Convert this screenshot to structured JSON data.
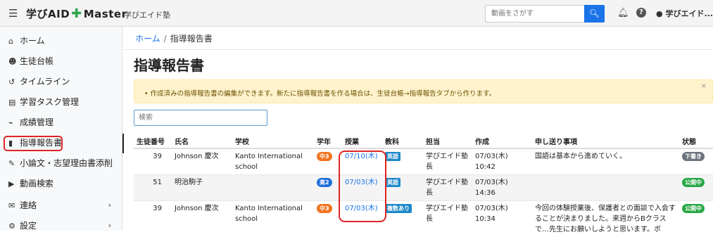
{
  "header": {
    "menu_icon": "hamburger-icon",
    "brand_left": "学びAID",
    "brand_right": "Master",
    "school": "学びエイド塾",
    "search_placeholder": "動画をさがす",
    "user_name": "学びエイド..."
  },
  "sidebar": {
    "items": [
      {
        "label": "ホーム",
        "icon": "home-icon"
      },
      {
        "label": "生徒台帳",
        "icon": "users-icon"
      },
      {
        "label": "タイムライン",
        "icon": "history-icon"
      },
      {
        "label": "学習タスク管理",
        "icon": "clipboard-icon"
      },
      {
        "label": "成績管理",
        "icon": "chart-icon"
      },
      {
        "label": "指導報告書",
        "icon": "file-icon"
      },
      {
        "label": "小論文・志望理由書添削",
        "icon": "pen-icon"
      },
      {
        "label": "動画検索",
        "icon": "video-icon"
      },
      {
        "label": "連絡",
        "icon": "contact-icon"
      },
      {
        "label": "設定",
        "icon": "settings-icon"
      }
    ]
  },
  "breadcrumb": {
    "home": "ホーム",
    "sep": "/",
    "current": "指導報告書"
  },
  "page_title": "指導報告書",
  "alert": {
    "text": "作成済みの指導報告書の編集ができます。新たに指導報告書を作る場合は、生徒台帳→指導報告タブから作ります。",
    "close": "×"
  },
  "filter": {
    "placeholder": "検索"
  },
  "table": {
    "headers": [
      "生徒番号",
      "氏名",
      "学校",
      "学年",
      "授業",
      "教科",
      "担当",
      "作成",
      "申し送り事項",
      "状態"
    ],
    "rows": [
      {
        "id": "39",
        "name": "Johnson 慶次",
        "school": "Kanto International school",
        "grade": "中3",
        "grade_color": "#f0731f",
        "lesson": "07/10(木)",
        "subject": "英語",
        "subject_color": "#1e88c7",
        "teacher": "学びエイド塾長",
        "created": "07/03(木) 10:42",
        "note": "国語は基本から進めていく。",
        "status": "下書き",
        "status_color": "#6c757d"
      },
      {
        "id": "51",
        "name": "明治駒子",
        "school": "",
        "grade": "高2",
        "grade_color": "#1e6fd9",
        "lesson": "07/03(木)",
        "subject": "英語",
        "subject_color": "#1e88c7",
        "teacher": "学びエイド塾長",
        "created": "07/03(木) 14:36",
        "note": "",
        "status": "公開中",
        "status_color": "#28a745"
      },
      {
        "id": "39",
        "name": "Johnson 慶次",
        "school": "Kanto International school",
        "grade": "中3",
        "grade_color": "#f0731f",
        "lesson": "07/03(木)",
        "subject": "複数あり",
        "subject_color": "#1e88c7",
        "teacher": "学びエイド塾長",
        "created": "07/03(木) 10:34",
        "note": "今回の体験授業後、保護者との面談で入会することが決まりました。来週からBクラスで…先生にお願いしようと思います。ボ",
        "status": "公開中",
        "status_color": "#28a745"
      }
    ]
  }
}
